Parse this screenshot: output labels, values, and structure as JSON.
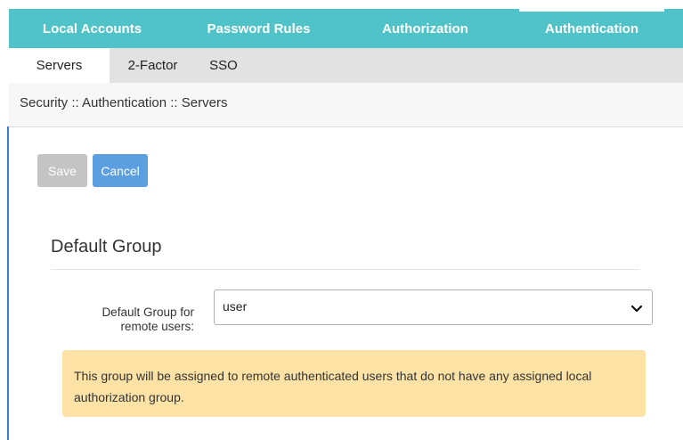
{
  "top_nav": {
    "tabs": [
      {
        "label": "Local Accounts"
      },
      {
        "label": "Password Rules"
      },
      {
        "label": "Authorization"
      },
      {
        "label": "Authentication"
      }
    ]
  },
  "sub_nav": {
    "tabs": [
      {
        "label": "Servers"
      },
      {
        "label": "2-Factor"
      },
      {
        "label": "SSO"
      }
    ]
  },
  "breadcrumb": "Security :: Authentication :: Servers",
  "toolbar": {
    "save_label": "Save",
    "cancel_label": "Cancel"
  },
  "section": {
    "title": "Default Group",
    "field_label_line1": "Default Group for",
    "field_label_line2": "remote users:",
    "select_value": "user",
    "notice": "This group will be assigned to remote authenticated users that do not have any assigned local authorization group."
  },
  "colors": {
    "top_nav_bg": "#4fc3c8",
    "cancel_button": "#5b9fe0",
    "save_button_disabled": "#c4c4c4",
    "notice_bg": "#fde2a6"
  },
  "icons": {
    "select_chevron": "chevron-down-icon"
  }
}
